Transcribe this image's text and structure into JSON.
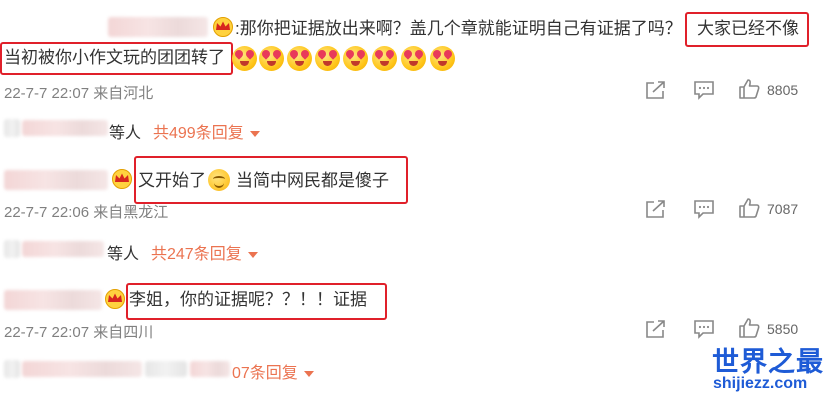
{
  "comments": [
    {
      "text_a": ":那你把证据放出来啊？盖几个章就能证明自己有证据了吗？",
      "text_b": "大家已经不像",
      "text_c": "当初被你小作文玩的团团转了",
      "meta": "22-7-7 22:07 来自河北",
      "likes": "8805",
      "reply_prefix": "等人",
      "reply_link": "共499条回复",
      "emoji_count": 8
    },
    {
      "text_a": "又开始了",
      "text_b": "当简中网民都是傻子",
      "meta": "22-7-7 22:06 来自黑龙江",
      "likes": "7087",
      "reply_prefix": "等人",
      "reply_link": "共247条回复"
    },
    {
      "text_a": "李姐，你的证据呢？？！！证据",
      "meta": "22-7-7 22:07 来自四川",
      "likes": "5850",
      "reply_link_partial": "07条回复"
    }
  ],
  "watermark": {
    "title": "世界之最",
    "url": "shijiezz.com"
  },
  "colors": {
    "highlight_border": "#e0202a",
    "reply_link": "#eb7350",
    "watermark": "#1e5bd6",
    "meta_text": "#808080"
  },
  "icons": [
    "crown-icon",
    "share-icon",
    "comment-icon",
    "like-icon",
    "emoji-face-icon",
    "smile-emoji-icon"
  ]
}
